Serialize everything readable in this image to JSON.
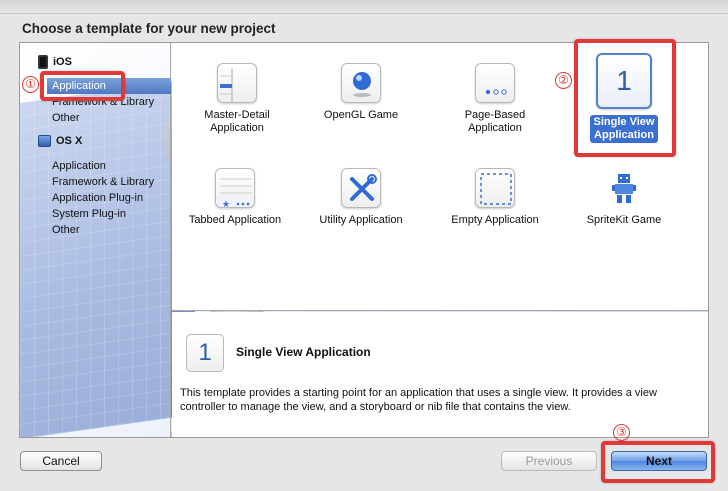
{
  "window": {
    "ghost_title": ""
  },
  "dialog": {
    "title": "Choose a template for your new project"
  },
  "sidebar": {
    "groups": [
      {
        "label": "iOS",
        "icon": "iphone-icon",
        "items": [
          "Application",
          "Framework & Library",
          "Other"
        ],
        "selected": "Application"
      },
      {
        "label": "OS X",
        "icon": "mac-app-icon",
        "items": [
          "Application",
          "Framework & Library",
          "Application Plug-in",
          "System Plug-in",
          "Other"
        ]
      }
    ]
  },
  "templates": [
    {
      "label_line1": "Master-Detail",
      "label_line2": "Application",
      "icon": "master-detail-icon"
    },
    {
      "label_line1": "OpenGL Game",
      "label_line2": "",
      "icon": "opengl-sphere-icon"
    },
    {
      "label_line1": "Page-Based",
      "label_line2": "Application",
      "icon": "page-dots-icon"
    },
    {
      "label_line1": "Single View",
      "label_line2": "Application",
      "icon": "single-view-icon",
      "glyph": "1",
      "selected": true
    },
    {
      "label_line1": "Tabbed Application",
      "label_line2": "",
      "icon": "tabbed-icon"
    },
    {
      "label_line1": "Utility Application",
      "label_line2": "",
      "icon": "tools-icon"
    },
    {
      "label_line1": "Empty Application",
      "label_line2": "",
      "icon": "empty-dashed-icon"
    },
    {
      "label_line1": "SpriteKit Game",
      "label_line2": "",
      "icon": "sprite-robot-icon"
    }
  ],
  "description": {
    "glyph": "1",
    "title": "Single View Application",
    "text": "This template provides a starting point for an application that uses a single view. It provides a view controller to manage the view, and a storyboard or nib file that contains the view."
  },
  "buttons": {
    "cancel": "Cancel",
    "previous": "Previous",
    "next": "Next"
  },
  "annotations": {
    "n1": "①",
    "n2": "②",
    "n3": "③",
    "color": "#e0393a"
  },
  "colors": {
    "selection": "#4f78c2",
    "accent_blue": "#2d5fa8"
  }
}
